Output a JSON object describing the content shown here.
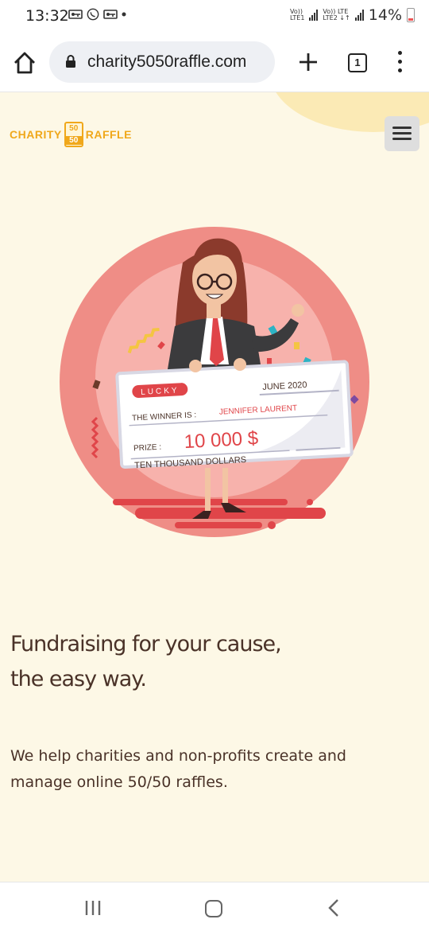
{
  "status_bar": {
    "time": "13:32",
    "battery": "14%",
    "sim1_top": "Vo))",
    "sim1_bottom": "LTE1",
    "sim2_top": "Vo)) LTE",
    "sim2_bottom": "LTE2 ↓↑"
  },
  "browser": {
    "url": "charity5050raffle.com",
    "tab_count": "1"
  },
  "site": {
    "logo": {
      "left_word": "CHARITY",
      "badge_top": "50",
      "badge_bottom": "50",
      "right_word": "RAFFLE"
    },
    "hero": {
      "check_brand": "LUCKY",
      "check_date": "JUNE 2020",
      "winner_label": "THE WINNER IS :",
      "winner_name": "JENNIFER LAURENT",
      "prize_label": "PRIZE :",
      "prize_amount": "10 000 $",
      "amount_words": "TEN THOUSAND DOLLARS"
    },
    "headline_line1": "Fundraising for your cause,",
    "headline_line2": "the easy way.",
    "description_line1": "We help charities and non-profits create and",
    "description_line2": "manage online 50/50 raffles."
  },
  "colors": {
    "page_background": "#fdf8e6",
    "brand_orange": "#f0a81b",
    "heading_text": "#4a3228",
    "hero_circle_outer": "#ef8d86",
    "hero_circle_inner": "#f7b2ac",
    "accent_red": "#e04549"
  }
}
